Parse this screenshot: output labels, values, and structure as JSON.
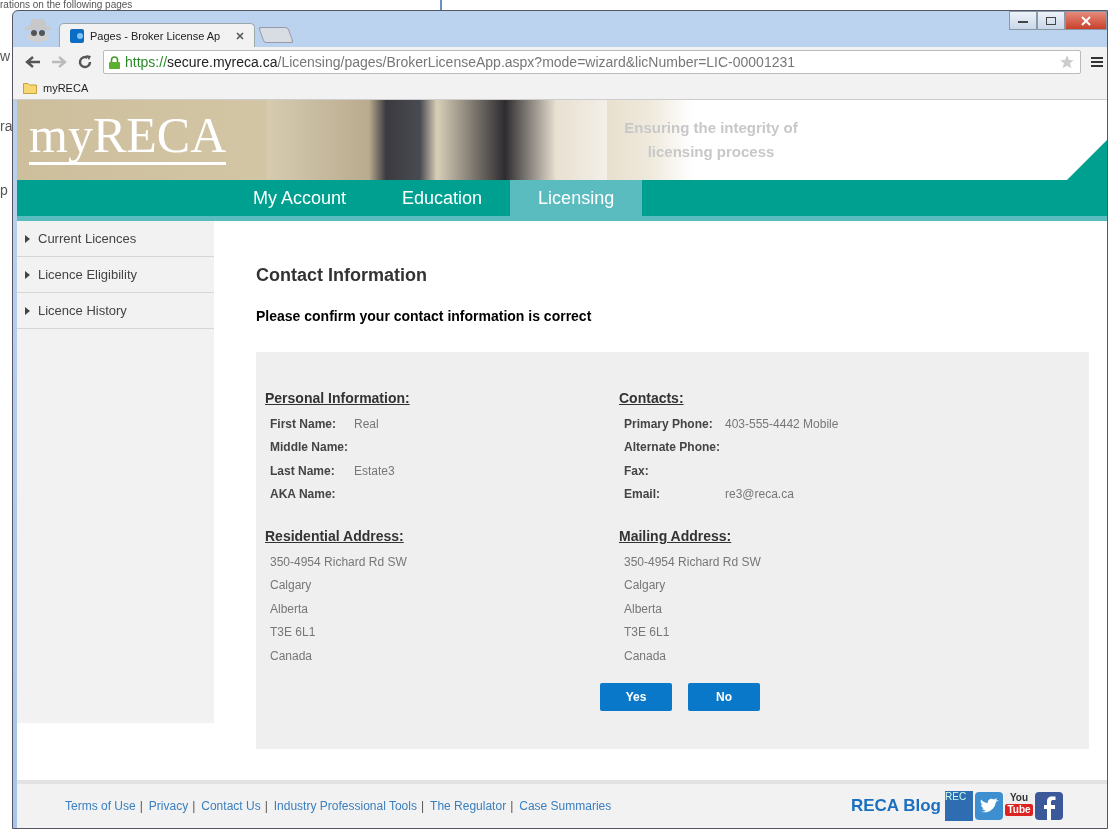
{
  "background_document": {
    "lines": [
      "rations on the following pages",
      "w",
      "ra",
      "p"
    ]
  },
  "browser": {
    "tabs": [
      {
        "title": "Pages - Broker License Ap",
        "selected": true
      }
    ],
    "url": {
      "scheme": "https://",
      "host": "secure.myreca.ca",
      "path": "/Licensing/pages/BrokerLicenseApp.aspx?mode=wizard&licNumber=LIC-00001231"
    },
    "bookmarks": [
      "myRECA"
    ]
  },
  "header": {
    "logo": "myRECA",
    "tagline": "Ensuring the integrity of licensing process"
  },
  "nav": [
    {
      "label": "My Account",
      "selected": false
    },
    {
      "label": "Education",
      "selected": false
    },
    {
      "label": "Licensing",
      "selected": true
    }
  ],
  "sidebar": {
    "items": [
      "Current Licences",
      "Licence Eligibility",
      "Licence History"
    ]
  },
  "page": {
    "title": "Contact Information",
    "prompt": "Please confirm your contact information is correct"
  },
  "sections": [
    {
      "kind": "fields",
      "heading": "Personal Information:",
      "fields": [
        {
          "label": "First Name:",
          "value": "Real"
        },
        {
          "label": "Middle Name:"
        },
        {
          "label": "Last Name:",
          "value": "Estate3"
        },
        {
          "label": "AKA Name:"
        }
      ]
    },
    {
      "kind": "fields",
      "heading": "Contacts:",
      "fields": [
        {
          "label": "Primary Phone:",
          "value": "403-555-4442 Mobile"
        },
        {
          "label": "Alternate Phone:"
        },
        {
          "label": "Fax:"
        },
        {
          "label": "Email:",
          "value": "re3@reca.ca"
        }
      ]
    },
    {
      "kind": "address",
      "heading": "Residential Address:",
      "lines": [
        "350-4954 Richard Rd SW",
        "Calgary",
        "Alberta",
        "T3E 6L1",
        "Canada"
      ]
    },
    {
      "kind": "address",
      "heading": "Mailing Address:",
      "lines": [
        "350-4954 Richard Rd SW",
        "Calgary",
        "Alberta",
        "T3E 6L1",
        "Canada"
      ]
    }
  ],
  "buttons": [
    "Yes",
    "No"
  ],
  "footer": {
    "links": [
      "Terms of Use",
      "Privacy",
      "Contact Us",
      "Industry Professional Tools",
      "The Regulator",
      "Case Summaries"
    ],
    "separator": "|",
    "blog": "RECA Blog",
    "social": [
      {
        "kind": "blog",
        "text": "REC"
      },
      {
        "kind": "twitter"
      },
      {
        "kind": "youtube",
        "top": "You",
        "bottom": "Tube"
      },
      {
        "kind": "facebook"
      }
    ]
  }
}
